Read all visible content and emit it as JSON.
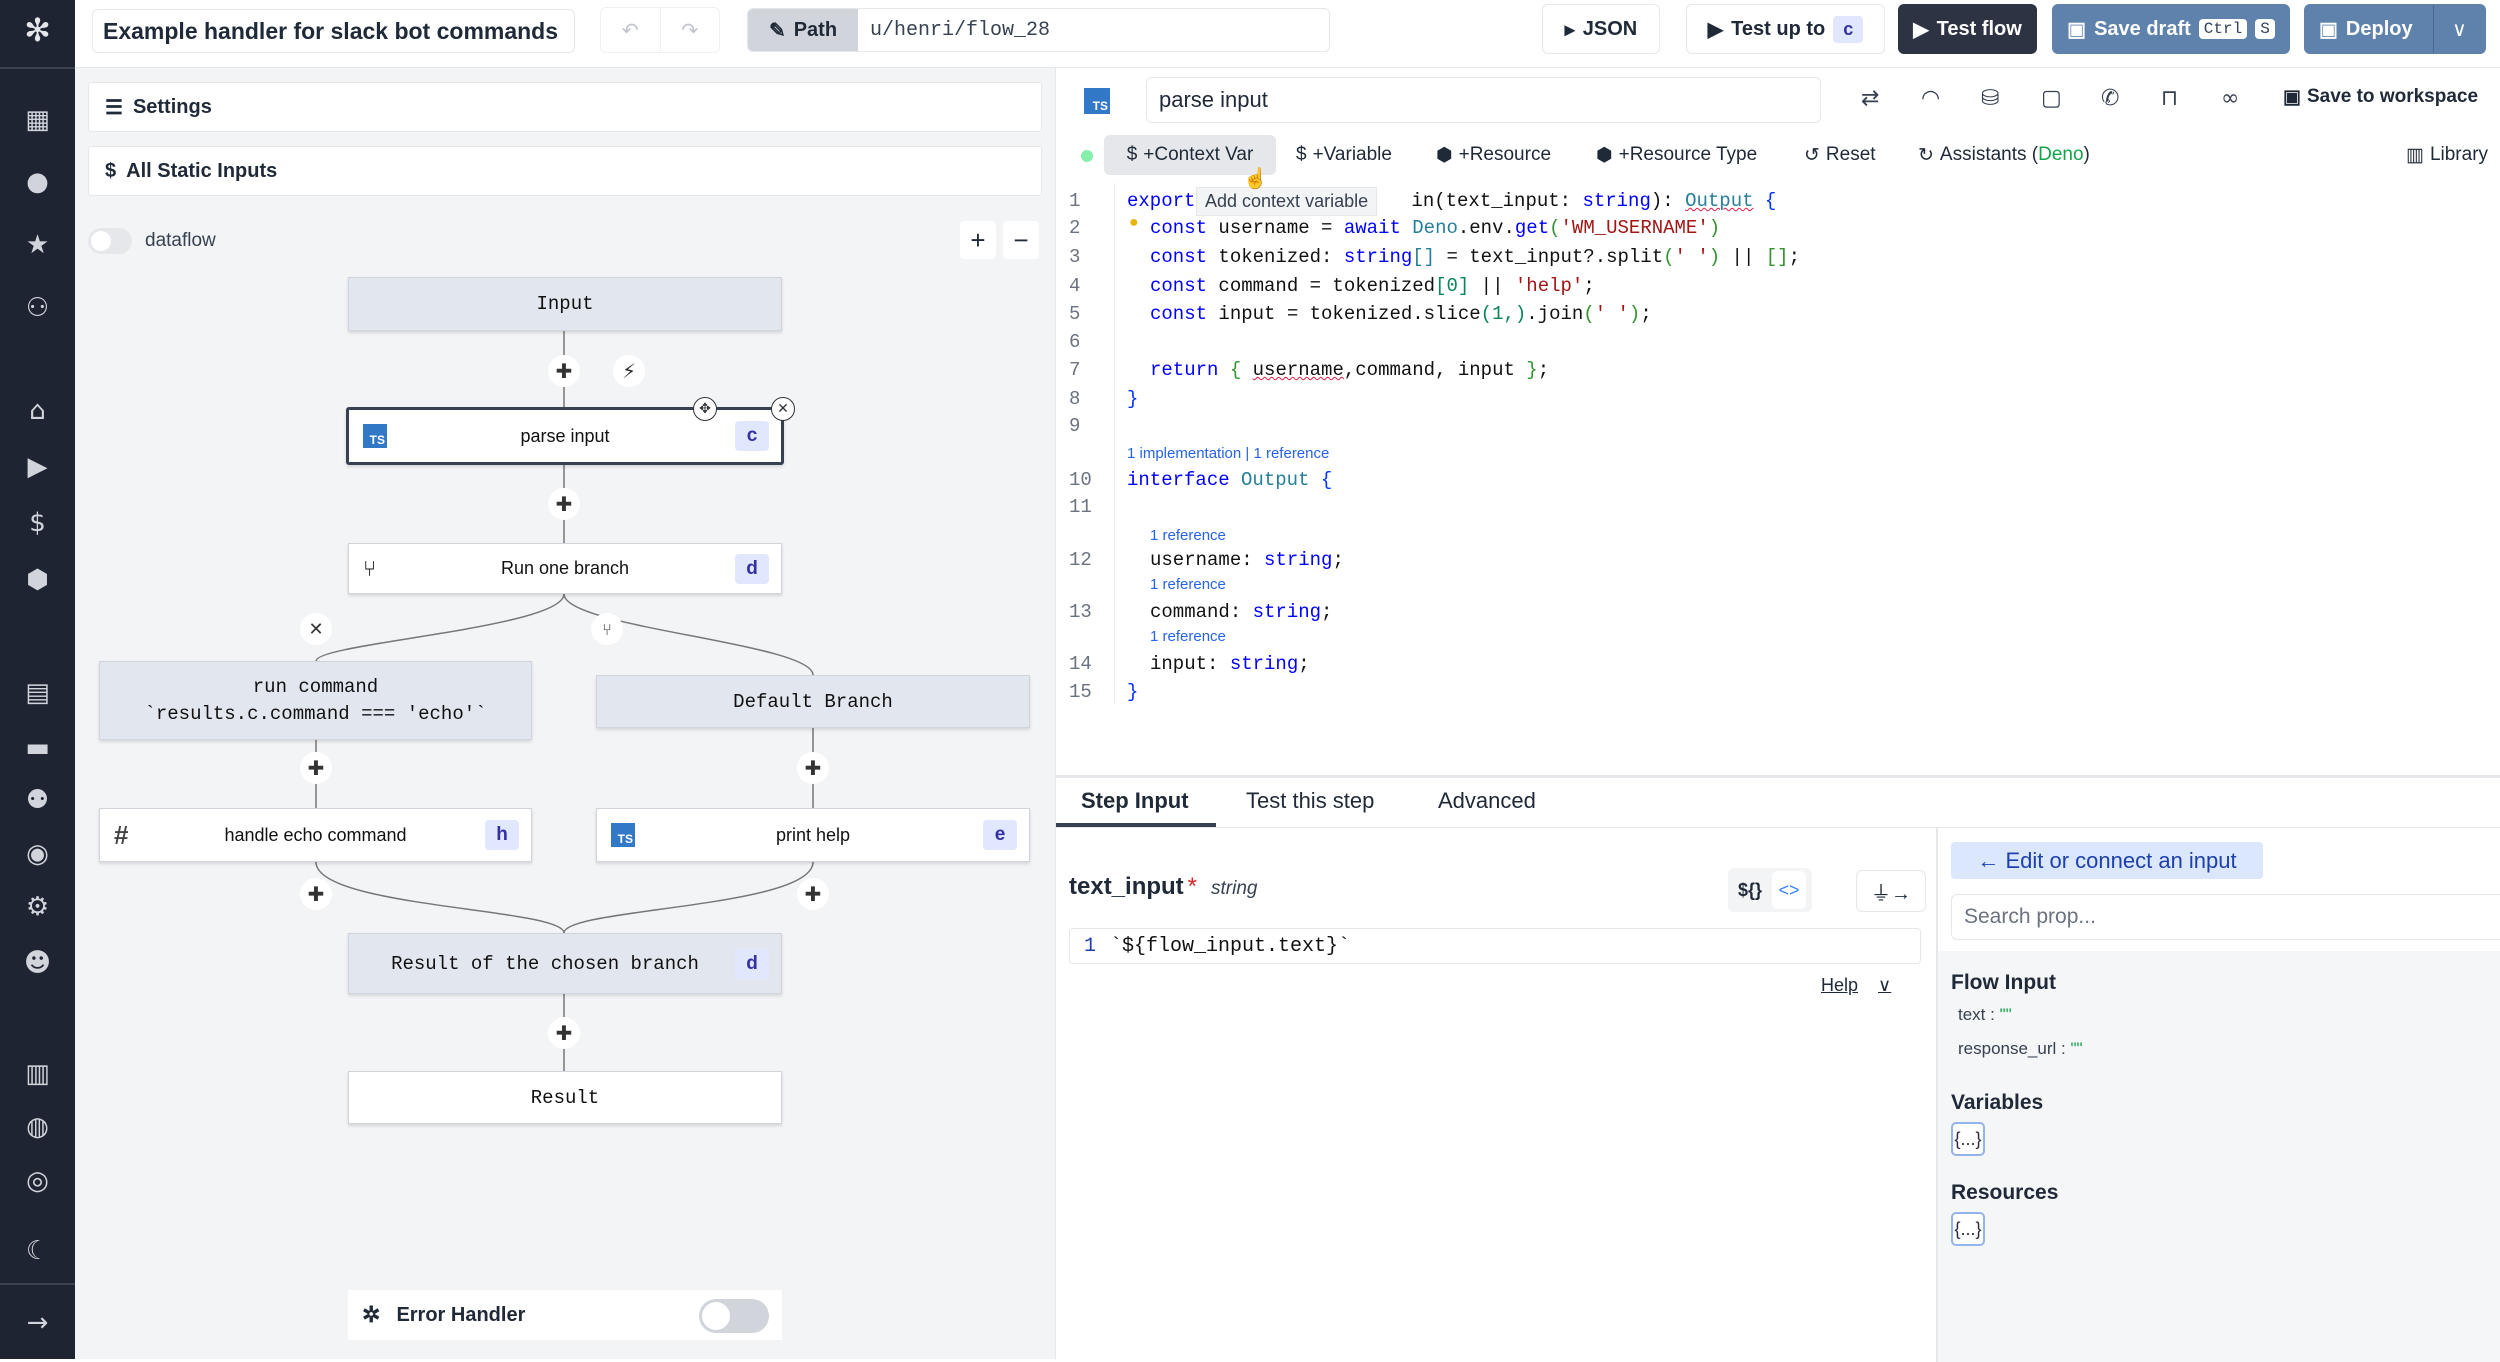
{
  "sidebar": {
    "icons": [
      "windmill-logo-icon",
      "building-icon",
      "user-icon",
      "star-icon",
      "users-icon",
      "home-icon",
      "play-icon",
      "dollar-icon",
      "cubes-icon",
      "calendar-icon",
      "folder-icon",
      "groups-icon",
      "eye-icon",
      "gear-icon",
      "bot-icon",
      "book-icon",
      "discord-icon",
      "github-icon",
      "moon-icon",
      "arrow-right-icon"
    ]
  },
  "topbar": {
    "title": "Example handler for slack bot commands",
    "path_label": "Path",
    "path_value": "u/henri/flow_28",
    "json_label": "JSON",
    "test_up_to_label": "Test up to",
    "test_up_to_step": "c",
    "test_flow_label": "Test flow",
    "save_draft_label": "Save draft",
    "save_draft_keys": [
      "Ctrl",
      "S"
    ],
    "deploy_label": "Deploy"
  },
  "left": {
    "settings_label": "Settings",
    "static_inputs_label": "All Static Inputs",
    "dataflow_label": "dataflow",
    "dataflow_on": false,
    "zoom_in": "+",
    "zoom_out": "−",
    "nodes": {
      "input": "Input",
      "parse": {
        "label": "parse input",
        "id": "c"
      },
      "branch": {
        "label": "Run one branch",
        "id": "d"
      },
      "run_command": {
        "line1": "run command",
        "line2": "`results.c.command === 'echo'`"
      },
      "default_branch": "Default Branch",
      "handle_echo": {
        "label": "handle echo command",
        "id": "h"
      },
      "print_help": {
        "label": "print help",
        "id": "e"
      },
      "result_branch": {
        "label": "Result of the chosen branch",
        "id": "d"
      },
      "result": "Result"
    },
    "error_handler_label": "Error Handler",
    "error_handler_on": false
  },
  "module": {
    "lang_badge": "TS",
    "name": "parse input",
    "save_to_workspace": "Save to workspace",
    "toolbar": {
      "context_var": "+Context Var",
      "variable": "+Variable",
      "resource": "+Resource",
      "resource_type": "+Resource Type",
      "reset": "Reset",
      "assistants": "Assistants (",
      "assistants_runtime": "Deno",
      "assistants_close": ")",
      "library": "Library"
    },
    "tooltip": "Add context variable",
    "status_color": "#86efac"
  },
  "editor": {
    "lines": [
      {
        "n": "1",
        "indent": 0,
        "tokens": [
          [
            "export",
            "kw"
          ],
          [
            "",
            "gap"
          ],
          [
            "in(text_input: ",
            "pl"
          ],
          [
            "string",
            "kw"
          ],
          [
            "): ",
            "pl"
          ],
          [
            "Output",
            "ty sq"
          ],
          [
            " {",
            "br"
          ]
        ]
      },
      {
        "n": "2",
        "indent": 1,
        "tokens": [
          [
            "const",
            "kw"
          ],
          [
            " username = ",
            "pl"
          ],
          [
            "await",
            "kw"
          ],
          [
            " Deno",
            "ty"
          ],
          [
            ".env.",
            "pl"
          ],
          [
            "get",
            "kw"
          ],
          [
            "(",
            "gr"
          ],
          [
            "'WM_USERNAME'",
            "st"
          ],
          [
            ")",
            "gr"
          ]
        ]
      },
      {
        "n": "3",
        "indent": 1,
        "tokens": [
          [
            "const",
            "kw"
          ],
          [
            " tokenized: ",
            "pl"
          ],
          [
            "string",
            "kw"
          ],
          [
            "[]",
            "ty"
          ],
          [
            " = text_input?.split",
            "pl"
          ],
          [
            "(",
            "gr"
          ],
          [
            "' '",
            "st"
          ],
          [
            ")",
            "gr"
          ],
          [
            " || ",
            "pl"
          ],
          [
            "[]",
            "gr"
          ],
          [
            ";",
            "pl"
          ]
        ]
      },
      {
        "n": "4",
        "indent": 1,
        "tokens": [
          [
            "const",
            "kw"
          ],
          [
            " command = tokenized",
            "pl"
          ],
          [
            "[0]",
            "nm"
          ],
          [
            " || ",
            "pl"
          ],
          [
            "'help'",
            "st"
          ],
          [
            ";",
            "pl"
          ]
        ]
      },
      {
        "n": "5",
        "indent": 1,
        "tokens": [
          [
            "const",
            "kw"
          ],
          [
            " input = tokenized.slice",
            "pl"
          ],
          [
            "(1,)",
            "nm"
          ],
          [
            ".join",
            "pl"
          ],
          [
            "(",
            "gr"
          ],
          [
            "' '",
            "st"
          ],
          [
            ")",
            "gr"
          ],
          [
            ";",
            "pl"
          ]
        ]
      },
      {
        "n": "6",
        "indent": 0,
        "tokens": []
      },
      {
        "n": "7",
        "indent": 1,
        "tokens": [
          [
            "return",
            "kw"
          ],
          [
            " { ",
            "gr"
          ],
          [
            "username",
            "pl sq"
          ],
          [
            ",command, input ",
            "pl"
          ],
          [
            "}",
            "gr"
          ],
          [
            ";",
            "pl"
          ]
        ]
      },
      {
        "n": "8",
        "indent": 0,
        "tokens": [
          [
            "}",
            "br"
          ]
        ]
      },
      {
        "n": "9",
        "indent": 0,
        "tokens": []
      },
      {
        "lens": "1 implementation | 1 reference",
        "indent": 0
      },
      {
        "n": "10",
        "indent": 0,
        "tokens": [
          [
            "interface",
            "kw"
          ],
          [
            " Output",
            "ty"
          ],
          [
            " {",
            "br"
          ]
        ]
      },
      {
        "n": "11",
        "indent": 0,
        "tokens": []
      },
      {
        "lens": "1 reference",
        "indent": 1
      },
      {
        "n": "12",
        "indent": 1,
        "tokens": [
          [
            "username: ",
            "pl"
          ],
          [
            "string",
            "kw"
          ],
          [
            ";",
            "pl"
          ]
        ]
      },
      {
        "lens": "1 reference",
        "indent": 1
      },
      {
        "n": "13",
        "indent": 1,
        "tokens": [
          [
            "command: ",
            "pl"
          ],
          [
            "string",
            "kw"
          ],
          [
            ";",
            "pl"
          ]
        ]
      },
      {
        "lens": "1 reference",
        "indent": 1
      },
      {
        "n": "14",
        "indent": 1,
        "tokens": [
          [
            "input: ",
            "pl"
          ],
          [
            "string",
            "kw"
          ],
          [
            ";",
            "pl"
          ]
        ]
      },
      {
        "n": "15",
        "indent": 0,
        "tokens": [
          [
            "}",
            "br"
          ]
        ]
      }
    ]
  },
  "bottom": {
    "tabs": [
      "Step Input",
      "Test this step",
      "Advanced"
    ],
    "active_tab": 0,
    "arg_name": "text_input",
    "arg_required": "*",
    "arg_type": "string",
    "mode_static": "${}",
    "mode_code": "<>",
    "input_line_no": "1",
    "input_expr": "`${flow_input.text}`",
    "help_label": "Help",
    "connect_label": "← Edit or connect an input",
    "search_placeholder": "Search prop...",
    "flow_input_title": "Flow Input",
    "flow_input_props": [
      {
        "key": "text",
        "value": "\"\""
      },
      {
        "key": "response_url",
        "value": "\"\""
      }
    ],
    "variables_title": "Variables",
    "resources_title": "Resources",
    "object_placeholder": "{...}"
  }
}
